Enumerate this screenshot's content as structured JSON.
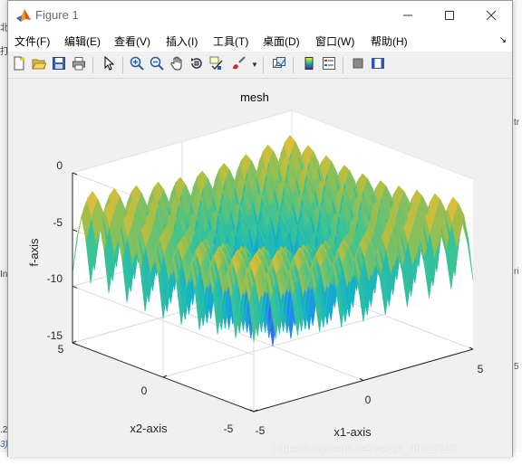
{
  "window": {
    "title": "Figure 1",
    "minimize_icon": "minimize-icon",
    "maximize_icon": "maximize-icon",
    "close_icon": "close-icon"
  },
  "menu": [
    {
      "label": "文件(F)"
    },
    {
      "label": "编辑(E)"
    },
    {
      "label": "查看(V)"
    },
    {
      "label": "插入(I)"
    },
    {
      "label": "工具(T)"
    },
    {
      "label": "桌面(D)"
    },
    {
      "label": "窗口(W)"
    },
    {
      "label": "帮助(H)"
    }
  ],
  "menu_dock_arrow": "↘",
  "toolbar": [
    {
      "icon": "new-figure-icon"
    },
    {
      "icon": "open-file-icon"
    },
    {
      "icon": "save-icon"
    },
    {
      "icon": "print-icon"
    },
    {
      "icon": "edit-plot-arrow-icon"
    },
    {
      "icon": "zoom-in-icon"
    },
    {
      "icon": "zoom-out-icon"
    },
    {
      "icon": "pan-hand-icon"
    },
    {
      "icon": "rotate-3d-icon"
    },
    {
      "icon": "data-cursor-icon"
    },
    {
      "icon": "brush-icon"
    },
    {
      "icon": "link-plot-icon"
    },
    {
      "icon": "colorbar-icon"
    },
    {
      "icon": "legend-icon"
    },
    {
      "icon": "hide-plot-tools-icon"
    },
    {
      "icon": "show-plot-tools-icon"
    }
  ],
  "chart_data": {
    "type": "surface",
    "title": "mesh",
    "xlabel": "x1-axis",
    "ylabel": "x2-axis",
    "zlabel": "f-axis",
    "xlim": [
      -5,
      5
    ],
    "ylim": [
      -5,
      5
    ],
    "zlim": [
      -15,
      0
    ],
    "xticks": [
      "-5",
      "0",
      "5"
    ],
    "yticks": [
      "-5",
      "0",
      "5"
    ],
    "zticks": [
      "0",
      "-5",
      "-10",
      "-15"
    ],
    "colormap": "parula",
    "grid": true,
    "peak": {
      "x1": 0,
      "x2": 0,
      "f": -1
    }
  },
  "watermark": "https://blog.csdn.net/weixin_45617915",
  "background": {
    "left_fragments": [
      "北",
      "打",
      "In",
      ".2",
      "3)"
    ],
    "right_fragments": [
      "tr",
      "ri",
      "5"
    ]
  }
}
